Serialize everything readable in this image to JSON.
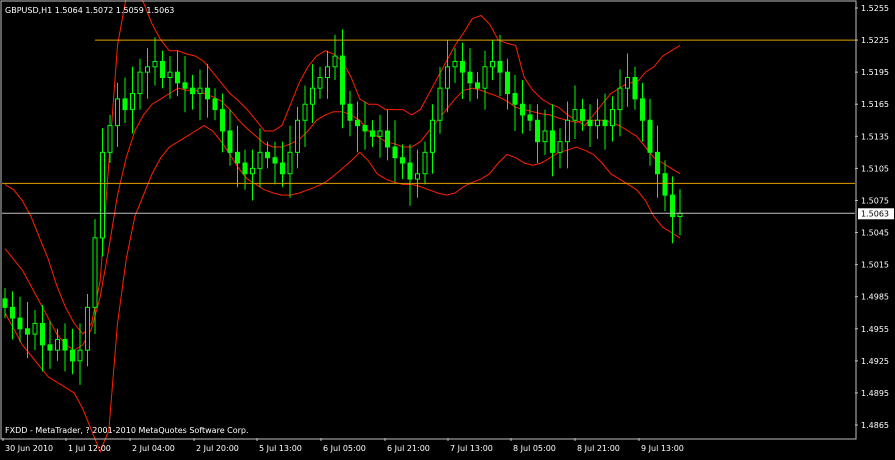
{
  "window": {
    "header": "GBPUSD,H1  1.5064 1.5072 1.5059 1.5063",
    "footer": "FXDD - MetaTrader, ? 2001-2010 MetaQuotes Software Corp.",
    "current_price_label": "1.5063"
  },
  "colors": {
    "background": "#000000",
    "grid_frame": "#c0c0c0",
    "candle": "#00ff00",
    "bollinger": "#ff2000",
    "level_line": "#e0a000",
    "current_price_line": "#c0c0c0",
    "text": "#ffffff"
  },
  "chart_data": {
    "type": "line",
    "subtype": "candlestick with Bollinger bands",
    "symbol": "GBPUSD",
    "timeframe": "H1",
    "ohlc_latest": {
      "open": 1.5064,
      "high": 1.5072,
      "low": 1.5059,
      "close": 1.5063
    },
    "ylim": [
      1.4865,
      1.5255
    ],
    "y_ticks": [
      "1.5255",
      "1.5225",
      "1.5195",
      "1.5165",
      "1.5135",
      "1.5105",
      "1.5075",
      "1.5045",
      "1.5015",
      "1.4985",
      "1.4955",
      "1.4925",
      "1.4895",
      "1.4865"
    ],
    "x_tick_labels": [
      "30 Jun 2010",
      "1 Jul 12:00",
      "2 Jul 04:00",
      "2 Jul 20:00",
      "5 Jul 13:00",
      "6 Jul 05:00",
      "6 Jul 21:00",
      "7 Jul 13:00",
      "8 Jul 05:00",
      "8 Jul 21:00",
      "9 Jul 13:00"
    ],
    "horizontal_levels": [
      1.5225,
      1.5091
    ],
    "current_price": 1.5063,
    "series": [
      {
        "name": "Close",
        "values": [
          1.4975,
          1.4965,
          1.4955,
          1.495,
          1.496,
          1.494,
          1.4935,
          1.4945,
          1.4935,
          1.4925,
          1.4935,
          1.4975,
          1.504,
          1.512,
          1.5145,
          1.517,
          1.516,
          1.5175,
          1.5195,
          1.52,
          1.5205,
          1.519,
          1.5195,
          1.5185,
          1.518,
          1.5175,
          1.518,
          1.517,
          1.516,
          1.514,
          1.512,
          1.511,
          1.51,
          1.5105,
          1.512,
          1.5115,
          1.511,
          1.51,
          1.512,
          1.515,
          1.5165,
          1.518,
          1.519,
          1.52,
          1.521,
          1.5165,
          1.515,
          1.5145,
          1.514,
          1.5135,
          1.514,
          1.5125,
          1.5115,
          1.511,
          1.5095,
          1.51,
          1.512,
          1.515,
          1.518,
          1.52,
          1.5205,
          1.5195,
          1.5185,
          1.518,
          1.52,
          1.5205,
          1.5195,
          1.5175,
          1.5165,
          1.5155,
          1.515,
          1.513,
          1.514,
          1.512,
          1.513,
          1.515,
          1.516,
          1.515,
          1.5145,
          1.515,
          1.5145,
          1.516,
          1.518,
          1.519,
          1.517,
          1.515,
          1.512,
          1.51,
          1.508,
          1.506,
          1.5063
        ]
      },
      {
        "name": "Upper band",
        "values": [
          1.509,
          1.5085,
          1.5075,
          1.506,
          1.504,
          1.502,
          1.4995,
          1.4975,
          1.496,
          1.495,
          1.496,
          1.5,
          1.511,
          1.522,
          1.5265,
          1.5275,
          1.526,
          1.524,
          1.5225,
          1.5215,
          1.5215,
          1.5212,
          1.521,
          1.5205,
          1.5195,
          1.5185,
          1.5175,
          1.5168,
          1.516,
          1.515,
          1.514,
          1.514,
          1.5145,
          1.5165,
          1.5185,
          1.52,
          1.521,
          1.5215,
          1.5212,
          1.5205,
          1.519,
          1.517,
          1.5165,
          1.5165,
          1.516,
          1.516,
          1.516,
          1.5155,
          1.516,
          1.5175,
          1.519,
          1.5205,
          1.522,
          1.5232,
          1.5245,
          1.5248,
          1.524,
          1.5225,
          1.5222,
          1.522,
          1.519,
          1.5178,
          1.517,
          1.5165,
          1.5162,
          1.5155,
          1.515,
          1.5145,
          1.5155,
          1.5165,
          1.5175,
          1.518,
          1.5185,
          1.5185,
          1.5195,
          1.52,
          1.521,
          1.5215,
          1.522
        ]
      },
      {
        "name": "Middle band",
        "values": [
          1.503,
          1.502,
          1.501,
          1.4995,
          1.498,
          1.4965,
          1.495,
          1.494,
          1.4935,
          1.494,
          1.4955,
          1.4985,
          1.503,
          1.508,
          1.5115,
          1.514,
          1.5155,
          1.5165,
          1.517,
          1.5175,
          1.518,
          1.5178,
          1.5178,
          1.5175,
          1.5172,
          1.5168,
          1.516,
          1.515,
          1.5142,
          1.5135,
          1.5128,
          1.5125,
          1.5125,
          1.5128,
          1.5132,
          1.514,
          1.515,
          1.5155,
          1.5158,
          1.5158,
          1.5155,
          1.515,
          1.514,
          1.5135,
          1.513,
          1.5128,
          1.5125,
          1.5125,
          1.513,
          1.514,
          1.515,
          1.516,
          1.517,
          1.5178,
          1.518,
          1.5178,
          1.5175,
          1.5172,
          1.5168,
          1.5162,
          1.516,
          1.5158,
          1.5156,
          1.5155,
          1.5152,
          1.515,
          1.5148,
          1.515,
          1.515,
          1.515,
          1.5148,
          1.5145,
          1.514,
          1.5135,
          1.5125,
          1.5115,
          1.511,
          1.5105,
          1.51
        ]
      },
      {
        "name": "Lower band",
        "values": [
          1.497,
          1.4955,
          1.494,
          1.493,
          1.492,
          1.491,
          1.4905,
          1.49,
          1.4895,
          1.488,
          1.486,
          1.484,
          1.486,
          1.496,
          1.502,
          1.506,
          1.508,
          1.51,
          1.5115,
          1.5125,
          1.513,
          1.5135,
          1.514,
          1.5145,
          1.514,
          1.513,
          1.5118,
          1.5105,
          1.5095,
          1.509,
          1.5085,
          1.5082,
          1.508,
          1.508,
          1.5082,
          1.5085,
          1.5088,
          1.5092,
          1.5098,
          1.5105,
          1.5112,
          1.512,
          1.5112,
          1.51,
          1.5095,
          1.5092,
          1.509,
          1.509,
          1.5088,
          1.5085,
          1.5082,
          1.508,
          1.5082,
          1.5088,
          1.5092,
          1.5095,
          1.51,
          1.511,
          1.5118,
          1.5115,
          1.511,
          1.5108,
          1.511,
          1.5115,
          1.512,
          1.5122,
          1.5125,
          1.5122,
          1.5118,
          1.511,
          1.51,
          1.5095,
          1.509,
          1.5085,
          1.5075,
          1.506,
          1.505,
          1.5045,
          1.504
        ]
      }
    ],
    "grid": false,
    "legend": "none"
  }
}
